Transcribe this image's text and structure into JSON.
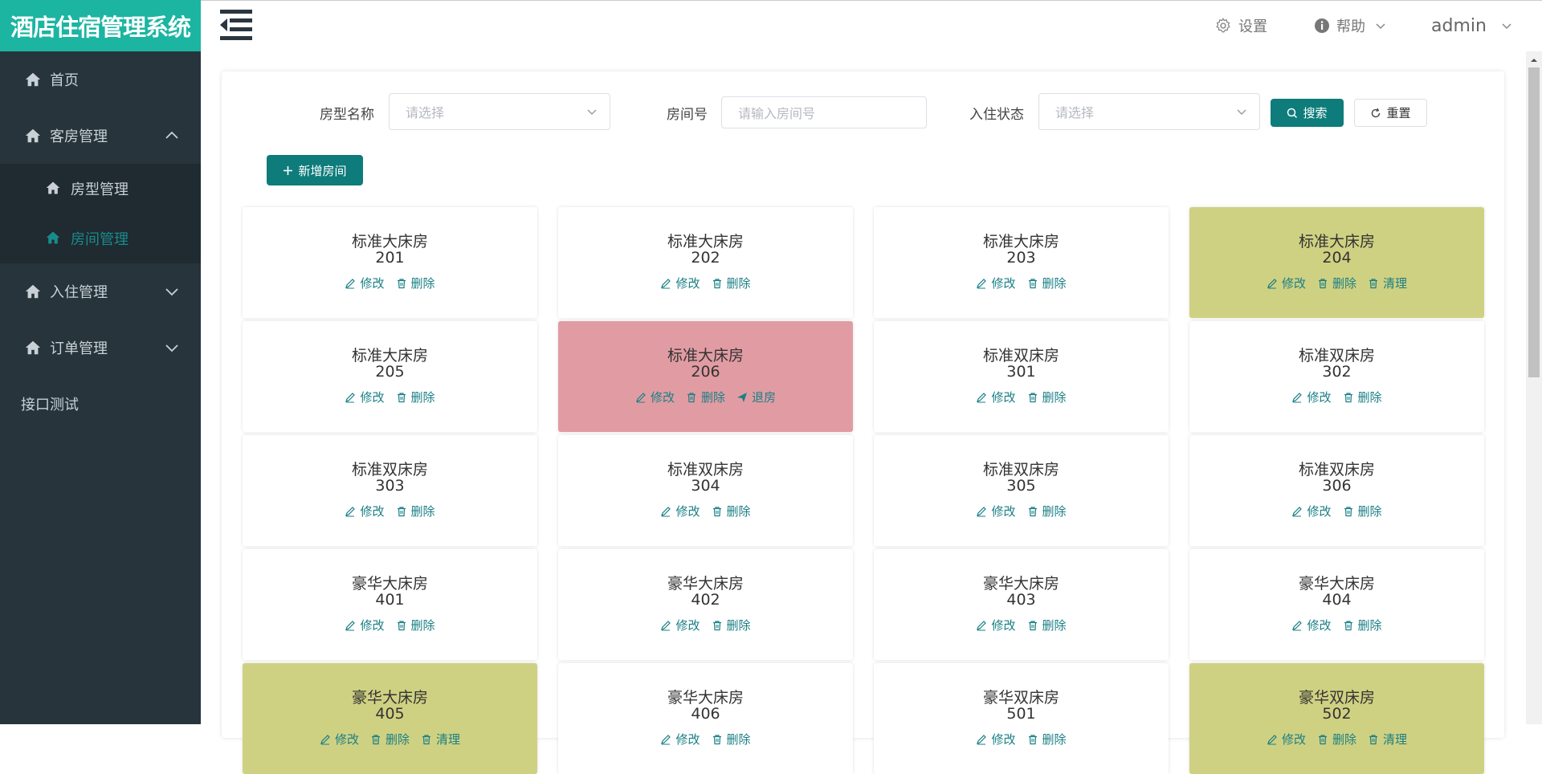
{
  "app": {
    "title": "酒店住宿管理系统"
  },
  "sidebar": {
    "items": [
      {
        "label": "首页"
      },
      {
        "label": "客房管理"
      },
      {
        "label": "房型管理"
      },
      {
        "label": "房间管理"
      },
      {
        "label": "入住管理"
      },
      {
        "label": "订单管理"
      },
      {
        "label": "接口测试"
      }
    ]
  },
  "header": {
    "settings": "设置",
    "help": "帮助",
    "user": "admin"
  },
  "filters": {
    "room_type_label": "房型名称",
    "room_type_placeholder": "请选择",
    "room_no_label": "房间号",
    "room_no_placeholder": "请输入房间号",
    "status_label": "入住状态",
    "status_placeholder": "请选择",
    "search_label": "搜索",
    "reset_label": "重置",
    "add_label": "新增房间"
  },
  "actions": {
    "edit": "修改",
    "delete": "删除",
    "clean": "清理",
    "checkout": "退房"
  },
  "colors": {
    "accent": "#0e7c7b",
    "logo_bg": "#1bb5a2",
    "sidebar_bg": "#27343c",
    "occupied": "#e19ca3",
    "dirty": "#cfd182"
  },
  "rooms": [
    {
      "type": "标准大床房",
      "number": "201",
      "status": "free"
    },
    {
      "type": "标准大床房",
      "number": "202",
      "status": "free"
    },
    {
      "type": "标准大床房",
      "number": "203",
      "status": "free"
    },
    {
      "type": "标准大床房",
      "number": "204",
      "status": "dirty"
    },
    {
      "type": "标准大床房",
      "number": "205",
      "status": "free"
    },
    {
      "type": "标准大床房",
      "number": "206",
      "status": "occupied"
    },
    {
      "type": "标准双床房",
      "number": "301",
      "status": "free"
    },
    {
      "type": "标准双床房",
      "number": "302",
      "status": "free"
    },
    {
      "type": "标准双床房",
      "number": "303",
      "status": "free"
    },
    {
      "type": "标准双床房",
      "number": "304",
      "status": "free"
    },
    {
      "type": "标准双床房",
      "number": "305",
      "status": "free"
    },
    {
      "type": "标准双床房",
      "number": "306",
      "status": "free"
    },
    {
      "type": "豪华大床房",
      "number": "401",
      "status": "free"
    },
    {
      "type": "豪华大床房",
      "number": "402",
      "status": "free"
    },
    {
      "type": "豪华大床房",
      "number": "403",
      "status": "free"
    },
    {
      "type": "豪华大床房",
      "number": "404",
      "status": "free"
    },
    {
      "type": "豪华大床房",
      "number": "405",
      "status": "dirty"
    },
    {
      "type": "豪华大床房",
      "number": "406",
      "status": "free"
    },
    {
      "type": "豪华双床房",
      "number": "501",
      "status": "free"
    },
    {
      "type": "豪华双床房",
      "number": "502",
      "status": "dirty"
    }
  ]
}
